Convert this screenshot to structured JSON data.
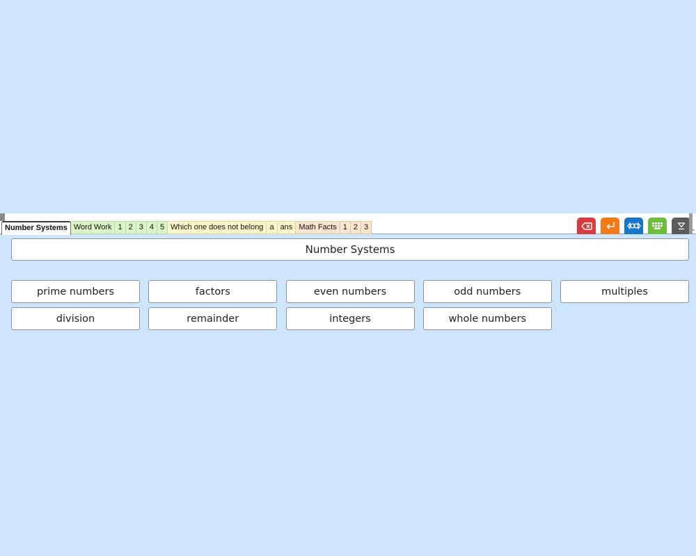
{
  "tabs": [
    {
      "label": "Number Systems",
      "group": "active"
    },
    {
      "label": "Word Work",
      "group": "green"
    },
    {
      "label": "1",
      "group": "green"
    },
    {
      "label": "2",
      "group": "green"
    },
    {
      "label": "3",
      "group": "green"
    },
    {
      "label": "4",
      "group": "green"
    },
    {
      "label": "5",
      "group": "green"
    },
    {
      "label": "Which one does not belong",
      "group": "yellow"
    },
    {
      "label": "a",
      "group": "yellow"
    },
    {
      "label": "ans",
      "group": "yellow"
    },
    {
      "label": "Math Facts",
      "group": "peach"
    },
    {
      "label": "1",
      "group": "peach"
    },
    {
      "label": "2",
      "group": "peach"
    },
    {
      "label": "3",
      "group": "peach"
    }
  ],
  "toolbar_icons": [
    {
      "name": "backspace-icon",
      "color": "#d83a3f"
    },
    {
      "name": "enter-icon",
      "color": "#f47a15"
    },
    {
      "name": "speak-icon",
      "color": "#1674c9"
    },
    {
      "name": "keyboard-icon",
      "color": "#6cbe3c"
    },
    {
      "name": "collapse-icon",
      "color": "#5b5b5b"
    }
  ],
  "title": "Number Systems",
  "words": [
    "prime numbers",
    "factors",
    "even numbers",
    "odd numbers",
    "multiples",
    "division",
    "remainder",
    "integers",
    "whole numbers"
  ],
  "colors": {
    "background": "#cde6fd",
    "tab_green": "#dcf3c8",
    "tab_yellow": "#fdf8c9",
    "tab_peach": "#fbe5cd"
  }
}
